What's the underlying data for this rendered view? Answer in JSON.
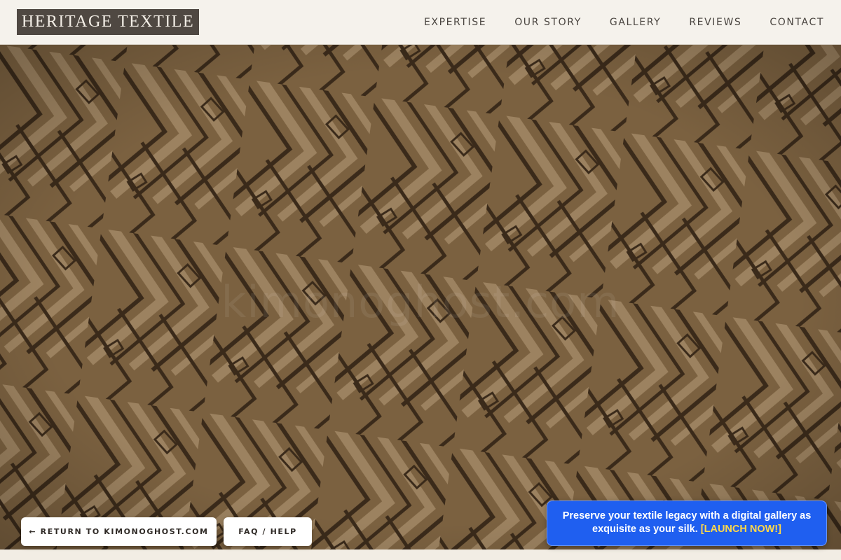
{
  "header": {
    "logo_text": "HERITAGE TEXTILE",
    "nav": [
      {
        "label": "EXPERTISE"
      },
      {
        "label": "OUR STORY"
      },
      {
        "label": "GALLERY"
      },
      {
        "label": "REVIEWS"
      },
      {
        "label": "CONTACT"
      }
    ]
  },
  "hero": {
    "watermark": "kimonoghost.com",
    "texture_colors": {
      "base": "#7b6140",
      "light": "#9c8260",
      "dark": "#3a2a1a"
    }
  },
  "buttons": {
    "return_label": "← RETURN TO KIMONOGHOST.COM",
    "faq_label": "FAQ / HELP"
  },
  "promo": {
    "text": "Preserve your textile legacy with a digital gallery as exquisite as your silk.",
    "link": "[LAUNCH NOW!]",
    "background": "#1f5ff0",
    "link_color": "#ffd84a"
  }
}
